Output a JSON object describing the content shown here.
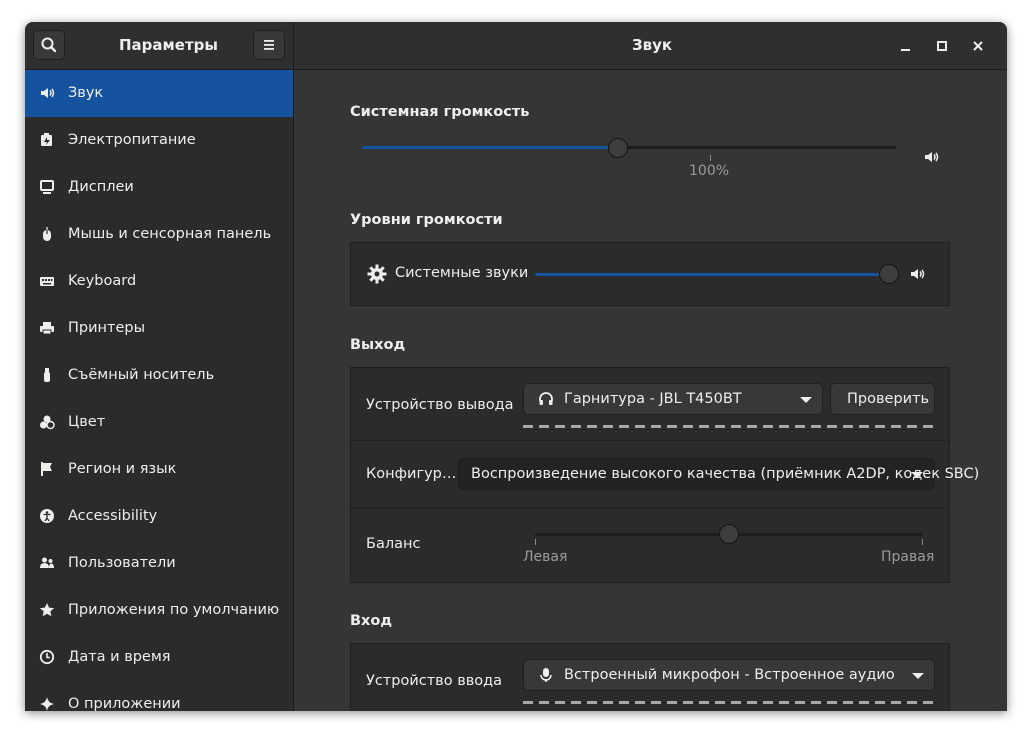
{
  "headerbar": {
    "sidebar_title": "Параметры",
    "page_title": "Звук"
  },
  "sidebar": {
    "items": [
      {
        "label": "Звук",
        "icon": "speaker-icon",
        "active": true
      },
      {
        "label": "Электропитание",
        "icon": "battery-icon"
      },
      {
        "label": "Дисплеи",
        "icon": "display-icon"
      },
      {
        "label": "Мышь и сенсорная панель",
        "icon": "mouse-icon"
      },
      {
        "label": "Keyboard",
        "icon": "keyboard-icon"
      },
      {
        "label": "Принтеры",
        "icon": "printer-icon"
      },
      {
        "label": "Съёмный носитель",
        "icon": "usb-icon"
      },
      {
        "label": "Цвет",
        "icon": "color-icon"
      },
      {
        "label": "Регион и язык",
        "icon": "flag-icon"
      },
      {
        "label": "Accessibility",
        "icon": "accessibility-icon"
      },
      {
        "label": "Пользователи",
        "icon": "users-icon"
      },
      {
        "label": "Приложения по умолчанию",
        "icon": "star-icon"
      },
      {
        "label": "Дата и время",
        "icon": "clock-icon"
      },
      {
        "label": "О приложении",
        "icon": "sparkle-icon"
      }
    ]
  },
  "system_volume": {
    "title": "Системная громкость",
    "value_percent": 48,
    "mark_label": "100%"
  },
  "volume_levels": {
    "title": "Уровни громкости",
    "system_sounds_label": "Системные звуки",
    "system_sounds_level": 100
  },
  "output": {
    "title": "Выход",
    "device_label": "Устройство вывода",
    "device_value": "Гарнитура - JBL T450BT",
    "test_button": "Проверить",
    "config_label": "Конфигур…",
    "config_value": "Воспроизведение высокого качества (приёмник A2DP, кодек SBC)",
    "balance_label": "Баланс",
    "balance_value": 0.5,
    "balance_left": "Левая",
    "balance_right": "Правая"
  },
  "input": {
    "title": "Вход",
    "device_label": "Устройство ввода",
    "device_value": "Встроенный микрофон - Встроенное аудио"
  },
  "colors": {
    "accent": "#15539e",
    "sidebar_bg": "#2b2b2b",
    "content_bg": "#353535"
  }
}
